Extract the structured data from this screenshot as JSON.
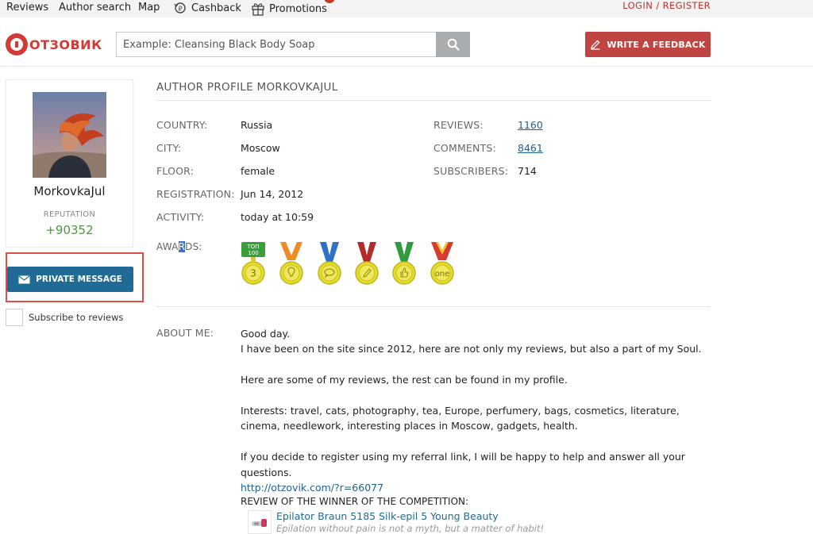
{
  "topnav": {
    "reviews": "Reviews",
    "author_search": "Author search",
    "map": "Map",
    "cashback": "Cashback",
    "promotions": "Promotions",
    "login": "LOGIN",
    "separator": "/",
    "register": "REGISTER"
  },
  "header": {
    "logo_text": "ОТЗОВИК",
    "search_placeholder": "Example: Cleansing Black Body Soap",
    "feedback_button": "WRITE A FEEDBACK"
  },
  "profile": {
    "username": "MorkovkaJul",
    "reputation_label": "REPUTATION",
    "reputation_value": "+90352",
    "private_message": "PRIVATE MESSAGE",
    "subscribe": "Subscribe to reviews"
  },
  "main": {
    "title": "AUTHOR PROFILE MORKOVKAJUL",
    "country_label": "COUNTRY:",
    "country": "Russia",
    "city_label": "CITY:",
    "city": "Moscow",
    "floor_label": "FLOOR:",
    "floor": "female",
    "registration_label": "REGISTRATION:",
    "registration": "Jun 14, 2012",
    "activity_label": "ACTIVITY:",
    "activity": "today at 10:59",
    "reviews_label": "REVIEWS:",
    "reviews": "1160",
    "comments_label": "COMMENTS:",
    "comments": "8461",
    "subscribers_label": "SUBSCRIBERS:",
    "subscribers": "714",
    "awards_label_a": "AWA",
    "awards_label_sel": "R",
    "awards_label_b": "DS:",
    "awards": [
      {
        "ribbon": "top",
        "top_text_1": "ТОП",
        "top_text_2": "100",
        "center": "3",
        "color": "#3a9e3a"
      },
      {
        "ribbon": "orange",
        "center": "",
        "color": "#f08a24"
      },
      {
        "ribbon": "blue",
        "center": "",
        "color": "#2d72c4"
      },
      {
        "ribbon": "red",
        "center": "",
        "color": "#b52a2a"
      },
      {
        "ribbon": "green",
        "center": "",
        "color": "#2f9a3e"
      },
      {
        "ribbon": "redyellow",
        "center": "one",
        "color": "#d93a2f"
      }
    ],
    "about_label": "ABOUT ME:",
    "about_1": "Good day.",
    "about_2": "I have been on the site since 2012, here are not only my reviews, but also a part of my Soul.",
    "about_3": "Here are some of my reviews, the rest can be found in my profile.",
    "about_4": "Interests: travel, cats, photography, tea, Europe, perfumery, bags, cosmetics, literature, cinema, needlework, interesting places in Moscow, gadgets, health.",
    "about_5": "If you decide to register using my referral link, I will be happy to help and answer all your questions.",
    "referral_link": "http://otzovik.com/?r=66077",
    "winner_label": "REVIEW OF THE WINNER OF THE COMPETITION:",
    "winner_title": "Epilator Braun 5185 Silk-epil 5 Young Beauty",
    "winner_subtitle": "Epilation without pain is not a myth, but a matter of habit!"
  },
  "colors": {
    "brand_red": "#d23a36",
    "feedback_red": "#c0443f",
    "pm_blue": "#1f6b96",
    "reputation_green": "#4b9a3e",
    "highlight_red": "#e04b4b"
  }
}
